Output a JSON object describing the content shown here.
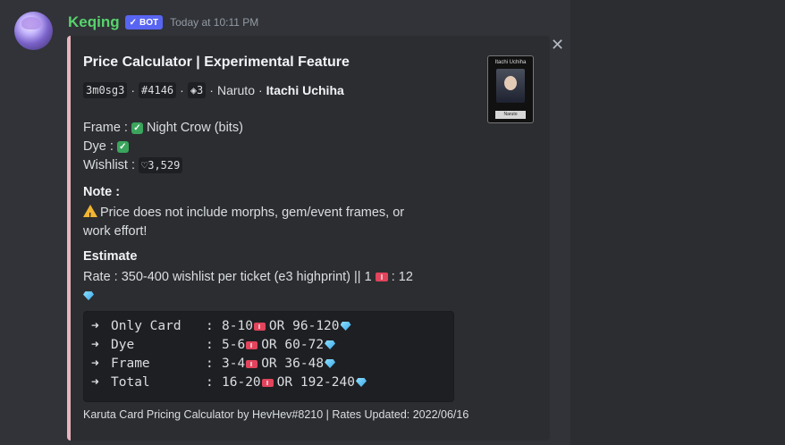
{
  "message": {
    "username": "Keqing",
    "bot_label": "BOT",
    "bot_check": "✓",
    "timestamp": "Today at 10:11 PM"
  },
  "embed": {
    "accent_color": "#e8b4be",
    "title": "Price Calculator | Experimental Feature",
    "card_code": "3m0sg3",
    "print_number": "#4146",
    "edition": "◈3",
    "separator": "·",
    "series": "Naruto",
    "character": "Itachi Uchiha",
    "thumbnail": {
      "name": "Itachi Uchiha",
      "series": "Naruto"
    },
    "fields": {
      "frame_label": "Frame :",
      "frame_value": "Night Crow (bits)",
      "dye_label": "Dye :",
      "wishlist_label": "Wishlist :",
      "wishlist_value": "♡3,529"
    },
    "note_heading": "Note :",
    "note_text_line1": "Price does not include morphs, gem/event frames, or",
    "note_text_line2": "work effort!",
    "estimate_heading": "Estimate",
    "rate_text": "Rate : 350-400 wishlist per ticket (e3 highprint) || 1",
    "rate_ticket_count": ": 12",
    "code_rows": [
      {
        "arrow": "➜",
        "label": "Only Card",
        "colon": ":",
        "tickets": "8-10",
        "or": "OR",
        "gems": "96-120"
      },
      {
        "arrow": "➜",
        "label": "Dye",
        "colon": ":",
        "tickets": "5-6",
        "or": "OR",
        "gems": "60-72"
      },
      {
        "arrow": "➜",
        "label": "Frame",
        "colon": ":",
        "tickets": "3-4",
        "or": "OR",
        "gems": "36-48"
      },
      {
        "arrow": "➜",
        "label": "Total",
        "colon": ":",
        "tickets": "16-20",
        "or": "OR",
        "gems": "192-240"
      }
    ],
    "footer": "Karuta Card Pricing Calculator by HevHev#8210 | Rates Updated: 2022/06/16"
  },
  "icons": {
    "close": "✕",
    "check": "✓"
  }
}
